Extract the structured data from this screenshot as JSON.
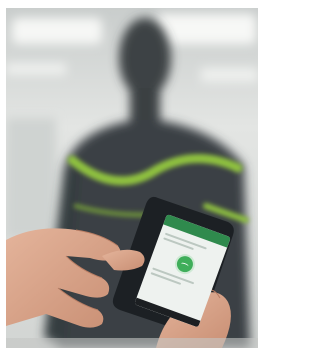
{
  "photo": {
    "subject": "hands-holding-phone",
    "background_subject": "mannequin-with-sensor-garment",
    "colors": {
      "background": "#d9dcdb",
      "mannequin": "#3c4244",
      "sensor_band": "#8fc13f",
      "skin": "#d9a48a",
      "phone_body": "#1c2024",
      "app_accent": "#2f8a4d",
      "app_status": "#3fae5a"
    }
  },
  "phone_app": {
    "status_icon": "signal-arc-icon"
  }
}
